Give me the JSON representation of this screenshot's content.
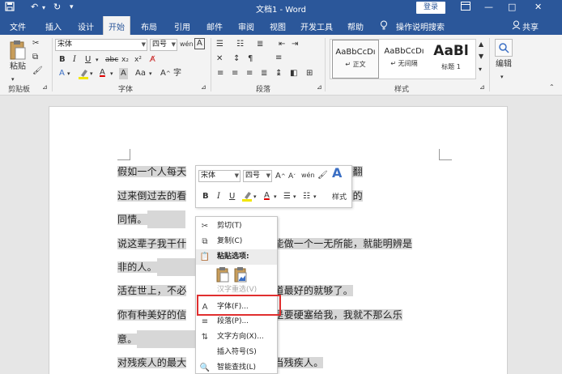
{
  "titlebar": {
    "title": "文档1 - Word",
    "login": "登录",
    "quick_access": [
      "save-icon",
      "undo-icon",
      "redo-icon",
      "customize-icon"
    ],
    "window_buttons": [
      "ribbon-display-icon",
      "minimize-icon",
      "restore-icon",
      "close-icon"
    ]
  },
  "tabs": [
    "文件",
    "插入",
    "设计",
    "开始",
    "布局",
    "引用",
    "邮件",
    "审阅",
    "视图",
    "开发工具",
    "帮助"
  ],
  "active_tab": "开始",
  "tell_me": "操作说明搜索",
  "share": "共享",
  "ribbon": {
    "clipboard": {
      "paste": "粘贴",
      "label": "剪贴板"
    },
    "font": {
      "name": "宋体",
      "size": "四号",
      "label": "字体"
    },
    "paragraph": {
      "label": "段落"
    },
    "styles": {
      "label": "样式",
      "items": [
        {
          "preview": "AaBbCcDı",
          "name": "↵ 正文"
        },
        {
          "preview": "AaBbCcDı",
          "name": "↵ 无间隔"
        },
        {
          "preview": "AaBl",
          "name": "标题 1"
        }
      ]
    },
    "editing": {
      "label": "编辑"
    }
  },
  "document": {
    "lines": [
      {
        "before": "假如一个人每天",
        "after": "把八个样板戏翻"
      },
      {
        "before": "过来倒过去的看",
        "after": "就值得我最大的"
      },
      {
        "before": "同情。",
        "after": ""
      },
      {
        "before": "说这辈子我干什",
        "after": "能做一个一无所能，就能明辨是"
      },
      {
        "before": "非的人。",
        "after": ""
      },
      {
        "before": "活在世上，不必",
        "after": "道最好的就够了。"
      },
      {
        "before": "你有种美好的信",
        "after": "是要硬塞给我，我就不那么乐"
      },
      {
        "before": "意。",
        "after": ""
      },
      {
        "before": "对残疾人的最大",
        "after": "当残疾人。"
      }
    ]
  },
  "minibar": {
    "font": "宋体",
    "size": "四号",
    "styles_label": "样式"
  },
  "context_menu": {
    "items": [
      {
        "icon": "scissors-icon",
        "label": "剪切(T)",
        "disabled": false
      },
      {
        "icon": "copy-icon",
        "label": "复制(C)",
        "disabled": false
      },
      {
        "icon": "paste-icon",
        "label": "粘贴选项:",
        "disabled": false,
        "header": true
      },
      {
        "icon": "",
        "label": "汉字重选(V)",
        "disabled": true
      },
      {
        "icon": "font-icon",
        "label": "字体(F)...",
        "disabled": false
      },
      {
        "icon": "paragraph-icon",
        "label": "段落(P)...",
        "disabled": false
      },
      {
        "icon": "text-direction-icon",
        "label": "文字方向(X)...",
        "disabled": false
      },
      {
        "icon": "",
        "label": "插入符号(S)",
        "disabled": false
      },
      {
        "icon": "smart-lookup-icon",
        "label": "智能查找(L)",
        "disabled": false
      }
    ]
  },
  "colors": {
    "accent": "#2b579a",
    "selection": "#d7d7d7",
    "highlight_box": "#e02f2f"
  }
}
